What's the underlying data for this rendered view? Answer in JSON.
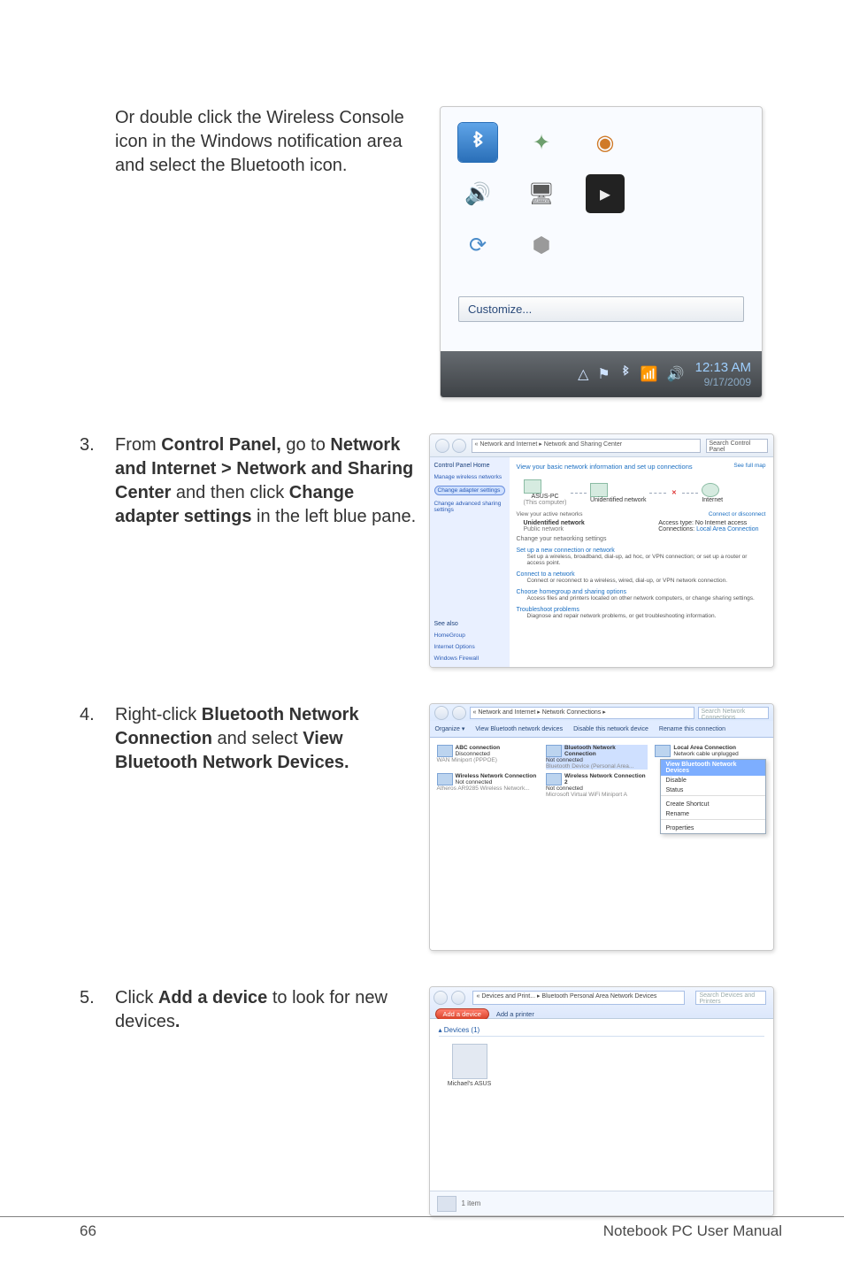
{
  "intro": {
    "text": "Or double click the Wireless Console icon in the Windows notification area and select the Bluetooth icon."
  },
  "tray": {
    "customize": "Customize...",
    "clock_time": "12:13 AM",
    "clock_date": "9/17/2009"
  },
  "step3": {
    "num": "3.",
    "pre": "From ",
    "b1": "Control Panel,",
    "mid1": " go to ",
    "b2": "Network and Internet > Network and Sharing Center",
    "mid2": " and then click ",
    "b3": "Change adapter settings",
    "post": " in the left blue pane."
  },
  "nsc": {
    "address": "« Network and Internet ▸ Network and Sharing Center",
    "search_ph": "Search Control Panel",
    "left_header": "Control Panel Home",
    "left_links": {
      "l0": "Manage wireless networks",
      "l1": "Change adapter settings",
      "l2": "Change advanced sharing settings"
    },
    "see_also": "See also",
    "see0": "HomeGroup",
    "see1": "Internet Options",
    "see2": "Windows Firewall",
    "view_title": "View your basic network information and set up connections",
    "see_full": "See full map",
    "map_pc": "ASUS-PC",
    "map_pc2": "(This computer)",
    "map_net": "Unidentified network",
    "map_inet": "Internet",
    "active_hdr": "View your active networks",
    "conn_disc": "Connect or disconnect",
    "net_name": "Unidentified network",
    "net_type": "Public network",
    "access_lbl": "Access type:",
    "access_val": "No Internet access",
    "conns_lbl": "Connections:",
    "conns_val": "Local Area Connection",
    "change_hdr": "Change your networking settings",
    "setup": "Set up a new connection or network",
    "setup_sub": "Set up a wireless, broadband, dial-up, ad hoc, or VPN connection; or set up a router or access point.",
    "connect": "Connect to a network",
    "connect_sub": "Connect or reconnect to a wireless, wired, dial-up, or VPN network connection.",
    "home": "Choose homegroup and sharing options",
    "home_sub": "Access files and printers located on other network computers, or change sharing settings.",
    "trouble": "Troubleshoot problems",
    "trouble_sub": "Diagnose and repair network problems, or get troubleshooting information."
  },
  "step4": {
    "num": "4.",
    "pre": "Right-click ",
    "b1": "Bluetooth Network Connection",
    "mid": " and select ",
    "b2": "View Bluetooth Network Devices."
  },
  "nc": {
    "address": "« Network and Internet ▸ Network Connections ▸",
    "search_ph": "Search Network Connections",
    "tools": {
      "t0": "Organize ▾",
      "t1": "View Bluetooth network devices",
      "t2": "Disable this network device",
      "t3": "Rename this connection"
    },
    "conn0_t": "ABC connection",
    "conn0_s": "Disconnected",
    "conn0_d": "WAN Miniport (PPPOE)",
    "conn1_t": "Bluetooth Network Connection",
    "conn1_s": "Not connected",
    "conn1_d": "Bluetooth Device (Personal Area...",
    "conn2_t": "Local Area Connection",
    "conn2_s": "Network cable unplugged",
    "conn3_t": "Wireless Network Connection",
    "conn3_s": "Not connected",
    "conn3_d": "Atheros AR9285 Wireless Network...",
    "conn4_t": "Wireless Network Connection 2",
    "conn4_s": "Not connected",
    "conn4_d": "Microsoft Virtual WiFi Miniport A",
    "ctx": {
      "c0": "View Bluetooth Network Devices",
      "c1": "Disable",
      "c2": "Status",
      "c3": "Create Shortcut",
      "c4": "Rename",
      "c5": "Properties"
    }
  },
  "step5": {
    "num": "5.",
    "pre": "Click ",
    "b1": "Add a device",
    "mid": " to look for new devices",
    "b2": "."
  },
  "dev": {
    "address": "« Devices and Print... ▸ Bluetooth Personal Area Network Devices",
    "search_ph": "Search Devices and Printers",
    "add_device": "Add a device",
    "add_printer": "Add a printer",
    "section": "▴ Devices (1)",
    "device_name": "Michael's ASUS",
    "footer": "1 item"
  },
  "footer": {
    "page": "66",
    "title": "Notebook PC User Manual"
  }
}
